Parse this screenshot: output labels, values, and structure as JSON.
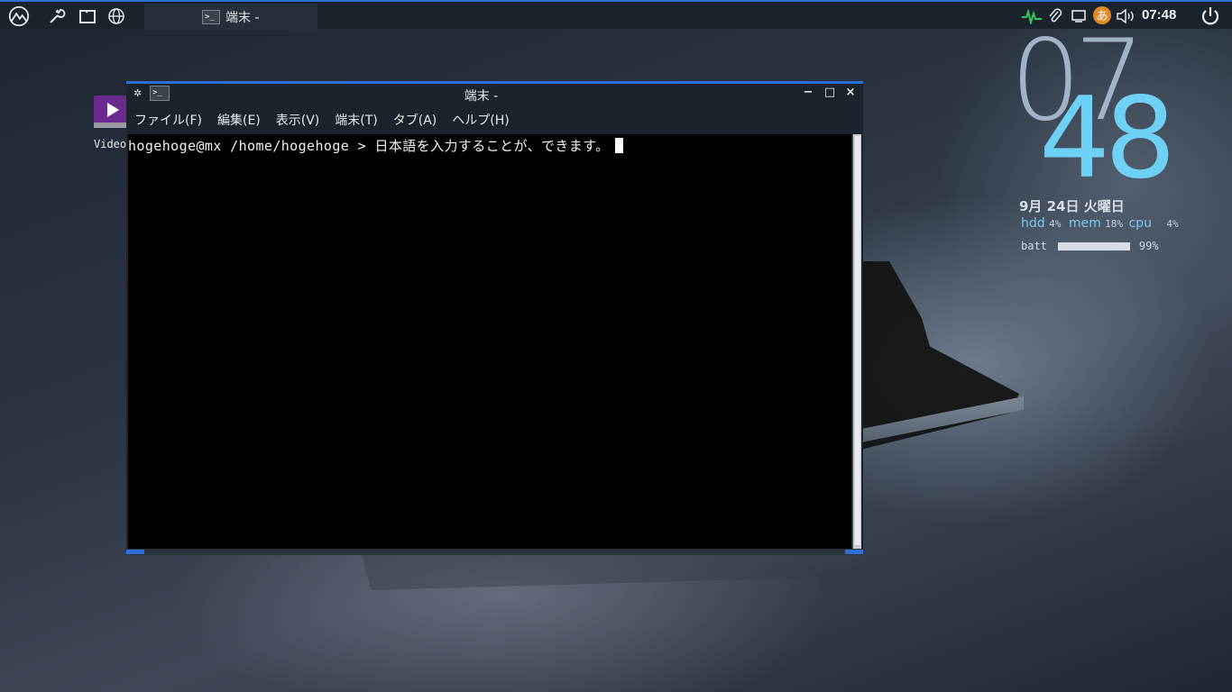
{
  "panel": {
    "launcher_icons": [
      "mx-logo-icon",
      "wrench-icon",
      "folder-icon",
      "globe-icon"
    ],
    "task": {
      "title": "端末 -"
    },
    "tray_icons": [
      "network-activity-icon",
      "paperclip-icon",
      "display-icon",
      "input-method-icon",
      "volume-icon"
    ],
    "clock": "07:48",
    "accent": "#2d6fd8"
  },
  "desktop": {
    "video_icon_label": "Video"
  },
  "window": {
    "title": "端末 -",
    "menu": [
      "ファイル(F)",
      "編集(E)",
      "表示(V)",
      "端末(T)",
      "タブ(A)",
      "ヘルプ(H)"
    ],
    "terminal_line": "hogehoge@mx /home/hogehoge > 日本語を入力することが、できます。"
  },
  "conky": {
    "hours": "07",
    "minutes": "48",
    "date": "9月 24日 火曜日",
    "hdd_label": "hdd",
    "hdd_val": "4%",
    "mem_label": "mem",
    "mem_val": "18%",
    "cpu_label": "cpu",
    "cpu_val": "4%",
    "batt_label": "batt",
    "batt_val": "99%",
    "batt_level": 0.99
  }
}
